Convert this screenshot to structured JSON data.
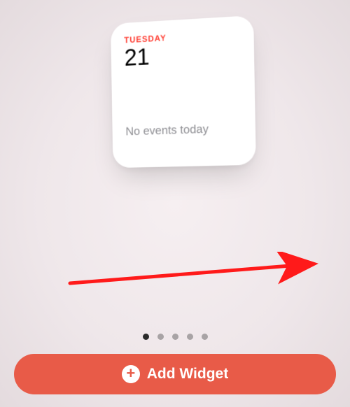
{
  "widget": {
    "day_label": "TUESDAY",
    "day_number": "21",
    "events_text": "No events today"
  },
  "pager": {
    "count": 5,
    "active_index": 0
  },
  "add_button": {
    "label": "Add Widget"
  },
  "colors": {
    "accent_red": "#ff3b30",
    "button_red": "#e85b48"
  }
}
